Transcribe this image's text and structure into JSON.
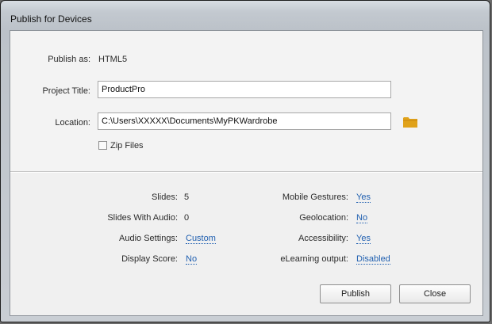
{
  "dialog": {
    "title": "Publish for Devices"
  },
  "form": {
    "publish_as_label": "Publish as:",
    "publish_as_value": "HTML5",
    "project_title_label": "Project Title:",
    "project_title_value": "ProductPro",
    "location_label": "Location:",
    "location_value": "C:\\Users\\XXXXX\\Documents\\MyPKWardrobe",
    "zip_files_label": "Zip Files",
    "zip_files_checked": false
  },
  "summary": {
    "left": [
      {
        "label": "Slides:",
        "value": "5",
        "is_link": false
      },
      {
        "label": "Slides With Audio:",
        "value": "0",
        "is_link": false
      },
      {
        "label": "Audio Settings:",
        "value": "Custom",
        "is_link": true
      },
      {
        "label": "Display Score:",
        "value": "No",
        "is_link": true
      }
    ],
    "right": [
      {
        "label": "Mobile Gestures:",
        "value": "Yes",
        "is_link": true
      },
      {
        "label": "Geolocation:",
        "value": "No",
        "is_link": true
      },
      {
        "label": "Accessibility:",
        "value": "Yes",
        "is_link": true
      },
      {
        "label": "eLearning output:",
        "value": "Disabled",
        "is_link": true
      }
    ]
  },
  "buttons": {
    "publish_label": "Publish",
    "close_label": "Close"
  },
  "colors": {
    "link": "#1f5fb0",
    "folder_icon": "#e0a21a"
  }
}
